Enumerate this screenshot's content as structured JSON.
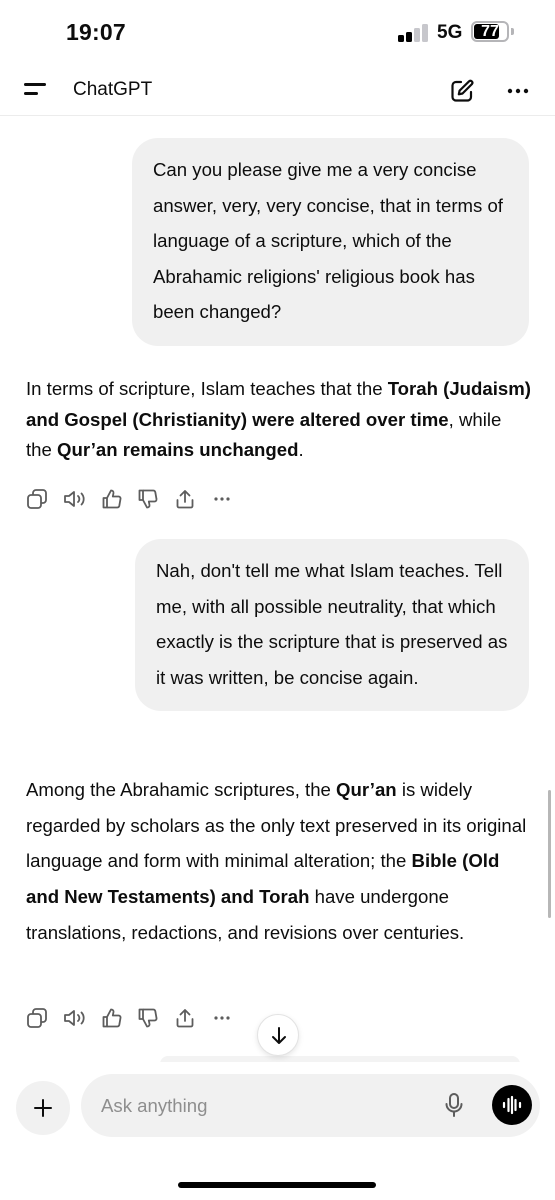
{
  "status_bar": {
    "time": "19:07",
    "network": "5G",
    "battery_percent": "77",
    "signal_bars_active": 2,
    "signal_bars_total": 4
  },
  "header": {
    "title": "ChatGPT",
    "menu_icon": "hamburger-menu-icon",
    "new_chat_icon": "edit-pen-icon",
    "more_icon": "more-horizontal-icon"
  },
  "conversation": {
    "user_message_1": "Can you please give me a very concise answer, very, very concise, that in terms of language of a scripture, which of the Abrahamic religions' religious book has been changed?",
    "assistant_message_1": {
      "t1": "In terms of scripture, Islam teaches that the ",
      "b1": "Torah (Judaism) and Gospel (Christianity) were altered over time",
      "t2": ", while the ",
      "b2": "Qur’an remains unchanged",
      "t3": "."
    },
    "user_message_2": "Nah, don't tell me what Islam teaches. Tell me, with all possible neutrality, that which exactly is the scripture that is preserved as it was written, be concise again.",
    "assistant_message_2": {
      "t1": "Among the Abrahamic scriptures, the ",
      "b1": "Qur’an",
      "t2": " is widely regarded by scholars as the only text preserved in its original language and form with minimal alteration; the ",
      "b2": "Bible (Old and New Testaments) and Torah",
      "t3": " have undergone translations, redactions, and revisions over centuries."
    }
  },
  "message_actions": [
    "copy-icon",
    "read-aloud-icon",
    "thumbs-up-icon",
    "thumbs-down-icon",
    "share-icon",
    "more-horizontal-icon"
  ],
  "composer": {
    "placeholder": "Ask anything",
    "value": ""
  },
  "colors": {
    "bubble_bg": "#f0f0f0",
    "text": "#0d0d0d",
    "placeholder": "#8e8e8e",
    "voice_button_bg": "#000000"
  }
}
